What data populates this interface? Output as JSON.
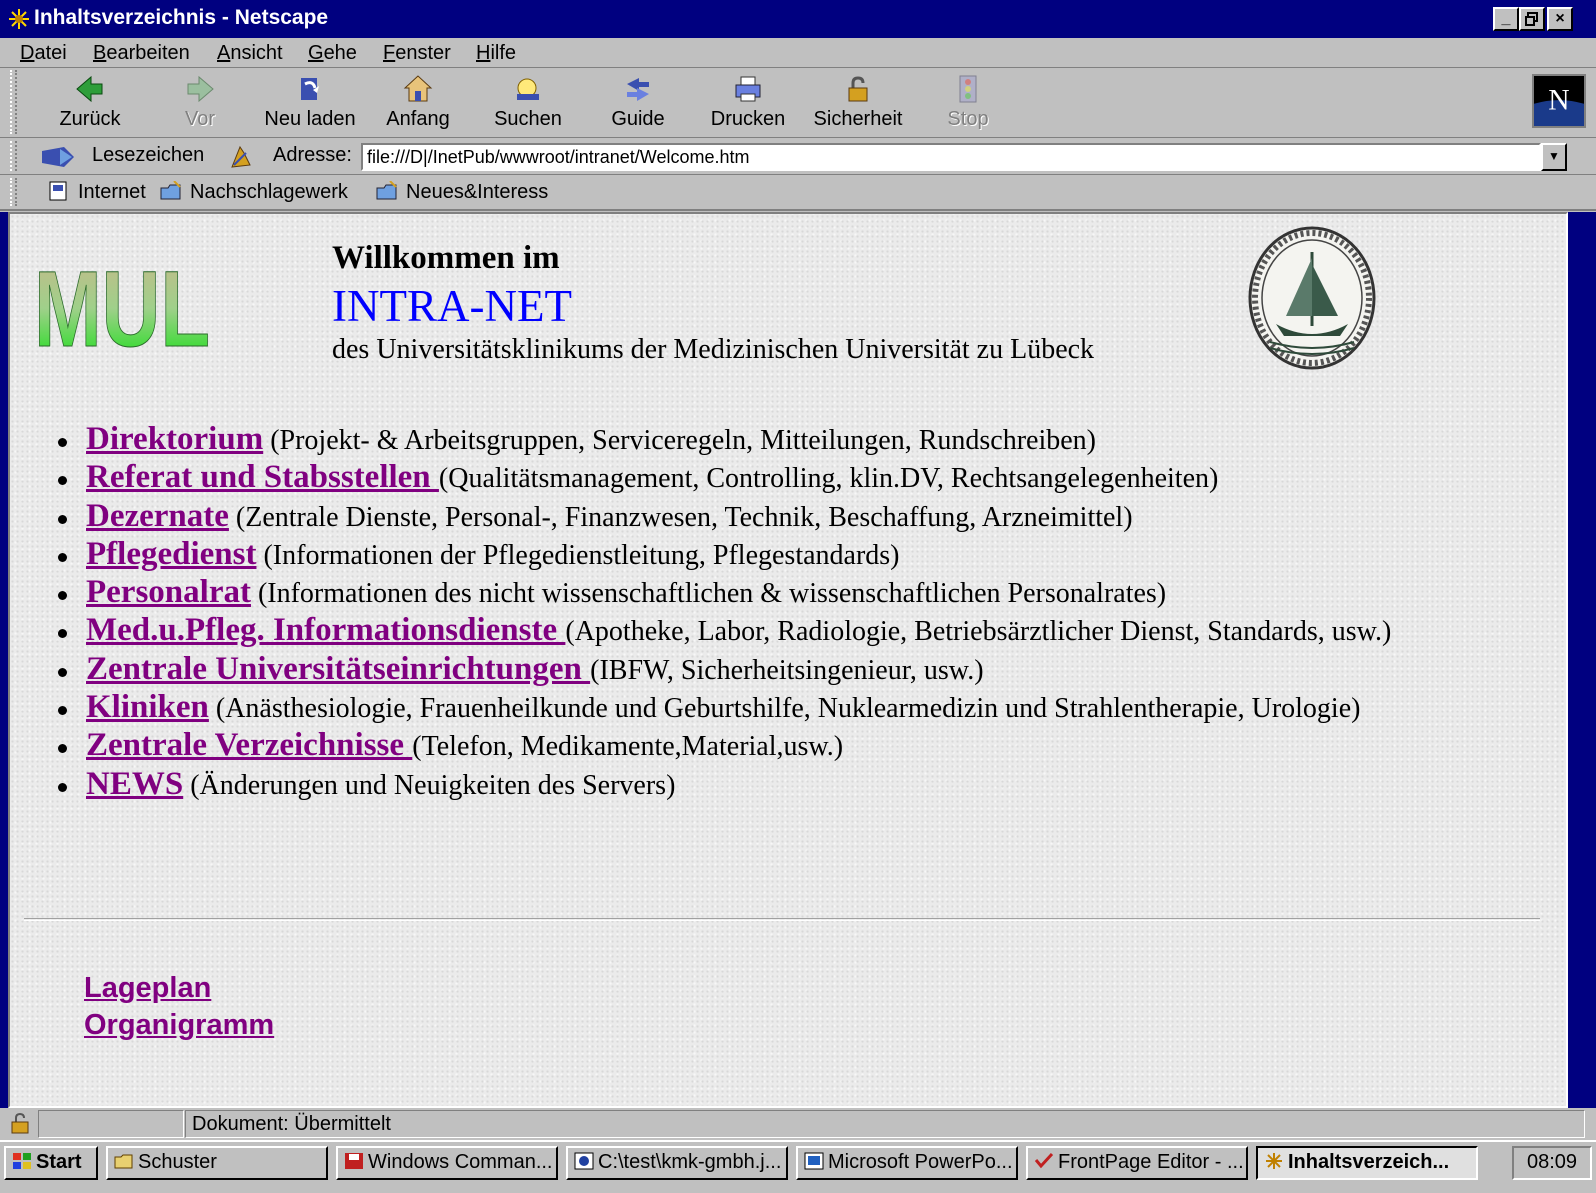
{
  "window": {
    "title": "Inhaltsverzeichnis - Netscape",
    "min": "_",
    "max": "▫",
    "close": "×"
  },
  "menu": [
    {
      "label": "Datei",
      "u": "D",
      "rest": "atei"
    },
    {
      "label": "Bearbeiten",
      "u": "B",
      "rest": "earbeiten"
    },
    {
      "label": "Ansicht",
      "u": "A",
      "rest": "nsicht"
    },
    {
      "label": "Gehe",
      "u": "G",
      "rest": "ehe"
    },
    {
      "label": "Fenster",
      "u": "F",
      "rest": "enster"
    },
    {
      "label": "Hilfe",
      "u": "H",
      "rest": "ilfe"
    }
  ],
  "toolbar": {
    "back": "Zurück",
    "forward": "Vor",
    "reload": "Neu laden",
    "home": "Anfang",
    "search": "Suchen",
    "guide": "Guide",
    "print": "Drucken",
    "security": "Sicherheit",
    "stop": "Stop"
  },
  "location": {
    "bookmarks": "Lesezeichen",
    "address_label": "Adresse:",
    "url": "file:///D|/InetPub/wwwroot/intranet/Welcome.htm"
  },
  "personal": {
    "item1": "Internet",
    "item2": "Nachschlagewerk",
    "item3": "Neues&Interess"
  },
  "page": {
    "logo_text": "MUL",
    "welcome": "Willkommen im",
    "intranet": "INTRA-NET",
    "subtitle": "des Universitätsklinikums der Medizinischen Universität zu Lübeck",
    "links": [
      {
        "title": "Direktorium",
        "desc": " (Projekt- & Arbeitsgruppen, Serviceregeln, Mitteilungen, Rundschreiben)"
      },
      {
        "title": "Referat und Stabsstellen ",
        "desc": "(Qualitätsmanagement, Controlling, klin.DV, Rechtsangelegenheiten)"
      },
      {
        "title": "Dezernate",
        "desc": " (Zentrale Dienste, Personal-, Finanzwesen, Technik, Beschaffung, Arzneimittel)"
      },
      {
        "title": "Pflegedienst",
        "desc": " (Informationen der Pflegedienstleitung, Pflegestandards)"
      },
      {
        "title": "Personalrat",
        "desc": " (Informationen des nicht wissenschaftlichen & wissenschaftlichen Personalrates)"
      },
      {
        "title": "Med.u.Pfleg. Informationsdienste ",
        "desc": "(Apotheke, Labor, Radiologie, Betriebsärztlicher Dienst, Standards, usw.)"
      },
      {
        "title": "Zentrale Universitätseinrichtungen ",
        "desc": "(IBFW, Sicherheitsingenieur, usw.)"
      },
      {
        "title": "Kliniken",
        "desc": " (Anästhesiologie, Frauenheilkunde und Geburtshilfe, Nuklearmedizin und Strahlentherapie, Urologie)"
      },
      {
        "title": "Zentrale Verzeichnisse ",
        "desc": "(Telefon, Medikamente,Material,usw.)"
      },
      {
        "title": "NEWS",
        "desc": " (Änderungen und Neuigkeiten des Servers)"
      }
    ],
    "footer_link1": "Lageplan",
    "footer_link2": "Organigramm"
  },
  "status": {
    "message": "Dokument: Übermittelt"
  },
  "taskbar": {
    "start": "Start",
    "tasks": [
      "Schuster",
      "Windows Comman...",
      "C:\\test\\kmk-gmbh.j...",
      "Microsoft PowerPo...",
      "FrontPage Editor - ...",
      "Inhaltsverzeich..."
    ],
    "clock": "08:09"
  },
  "colors": {
    "titlebar": "#000080",
    "link_visited": "#800080",
    "intranet_blue": "#0000ff",
    "chrome": "#c0c0c0"
  }
}
